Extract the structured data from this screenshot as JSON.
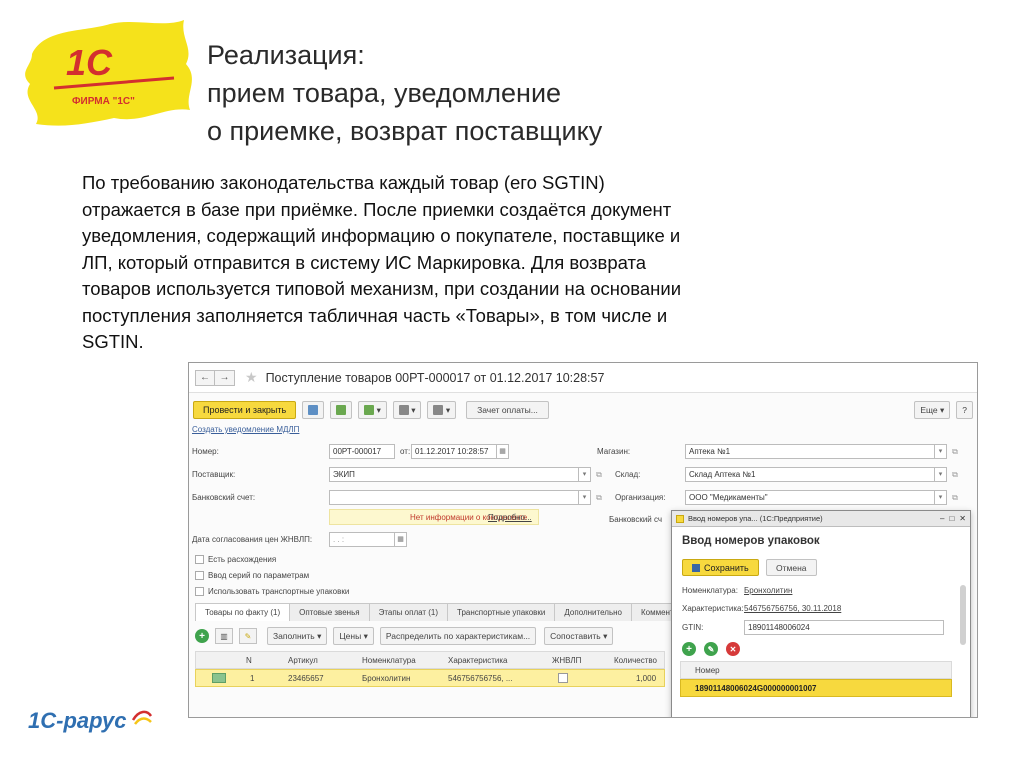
{
  "slide": {
    "logo_text": "1С",
    "logo_sub": "ФИРМА \"1С\"",
    "title_lines": [
      "Реализация:",
      "прием товара, уведомление",
      "о приемке, возврат поставщику"
    ],
    "body_lines": [
      "По требованию законодательства каждый товар (его SGTIN)",
      "отражается в базе при приёмке. После приемки создаётся документ",
      "уведомления, содержащий информацию о покупателе, поставщике и",
      "ЛП, который отправится в систему ИС Маркировка. Для возврата",
      "товаров используется типовой механизм, при создании на основании",
      "поступления заполняется табличная часть «Товары», в том числе и",
      "SGTIN."
    ],
    "footer_logo": "1С-рарус"
  },
  "window": {
    "title": "Поступление товаров 00РТ-000017 от 01.12.2017 10:28:57",
    "toolbar": {
      "post_close": "Провести и закрыть",
      "payment_offset": "Зачет оплаты...",
      "more": "Еще",
      "help": "?"
    },
    "create_link": "Создать уведомление МДЛП",
    "labels": {
      "number": "Номер:",
      "date_sep": "от:",
      "supplier": "Поставщик:",
      "bank_account": "Банковский счет:",
      "shop": "Магазин:",
      "warehouse": "Склад:",
      "organization": "Организация:",
      "bank_account_short": "Банковский сч",
      "price_date": "Дата согласования цен ЖНВЛП:"
    },
    "values": {
      "number": "00РТ-000017",
      "date": "01.12.2017 10:28:57",
      "supplier": "ЭКИП",
      "bank_account": "",
      "shop": "Аптека №1",
      "warehouse": "Склад Аптека №1",
      "organization": "ООО \"Медикаменты\"",
      "price_date": ". . :"
    },
    "warning": {
      "text": "Нет информации о контрагенте",
      "link": "Подробно..."
    },
    "checks": [
      "Есть расхождения",
      "Ввод серий по параметрам",
      "Использовать транспортные упаковки"
    ],
    "tabs": [
      "Товары по факту (1)",
      "Оптовые звенья",
      "Этапы оплат (1)",
      "Транспортные упаковки",
      "Дополнительно",
      "Коммент"
    ],
    "table_toolbar": {
      "fill": "Заполнить",
      "prices": "Цены",
      "distribute": "Распределить по характеристикам...",
      "compare": "Сопоставить"
    },
    "grid": {
      "columns": [
        "N",
        "Артикул",
        "Номенклатура",
        "Характеристика",
        "ЖНВЛП",
        "Количество"
      ],
      "rows": [
        {
          "n": "1",
          "article": "23465657",
          "name": "Бронхолитин",
          "characteristic": "546756756756, ...",
          "qty": "1,000"
        }
      ]
    }
  },
  "dialog": {
    "titlebar": "Ввод номеров упа... (1С:Предприятие)",
    "heading": "Ввод номеров упаковок",
    "save": "Сохранить",
    "cancel": "Отмена",
    "labels": {
      "nomenclature": "Номенклатура:",
      "characteristic": "Характеристика:",
      "gtin": "GTIN:"
    },
    "values": {
      "nomenclature": "Бронхолитин",
      "characteristic": "546756756756, 30.11.2018",
      "gtin": "18901148006024"
    },
    "list_header": "Номер",
    "list_rows": [
      "18901148006024G000000001007"
    ]
  },
  "colors": {
    "accent_yellow": "#f7d93e",
    "logo_red": "#d32f2f",
    "link_blue": "#3a5f9a",
    "row_highlight": "#fdf0a0"
  }
}
